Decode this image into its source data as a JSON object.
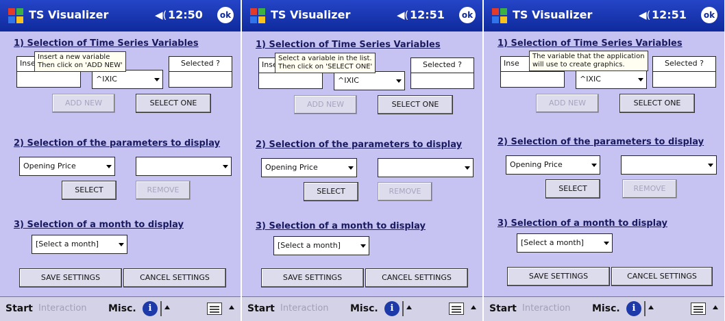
{
  "app_title": "TS Visualizer",
  "ok_label": "ok",
  "section1_title": "1) Selection of Time Series Variables",
  "section2_title": "2) Selection of the parameters to display",
  "section3_title": "3) Selection of a month to display",
  "insert_label": "Inse",
  "selected_label": "Selected ?",
  "variable_value": "^IXIC",
  "add_new_label": "ADD NEW",
  "select_one_label": "SELECT ONE",
  "param_value": "Opening Price",
  "select_label": "SELECT",
  "remove_label": "REMOVE",
  "month_value": "[Select a month]",
  "save_label": "SAVE SETTINGS",
  "cancel_label": "CANCEL SETTINGS",
  "taskbar": {
    "start": "Start",
    "interaction": "Interaction",
    "misc": "Misc.",
    "info": "i"
  },
  "screens": [
    {
      "time": "12:50",
      "tooltip_line1": "Insert a new variable",
      "tooltip_line2": "Then click on 'ADD NEW'"
    },
    {
      "time": "12:51",
      "tooltip_line1": "Select a variable in the list.",
      "tooltip_line2": "Then click on 'SELECT ONE'"
    },
    {
      "time": "12:51",
      "tooltip_line1": "The variable that the application",
      "tooltip_line2": "will use to create graphics."
    }
  ],
  "colors": {
    "title_bar": "#0f2a9c",
    "background": "#c6c3f2",
    "section_title": "#1a1a60"
  }
}
